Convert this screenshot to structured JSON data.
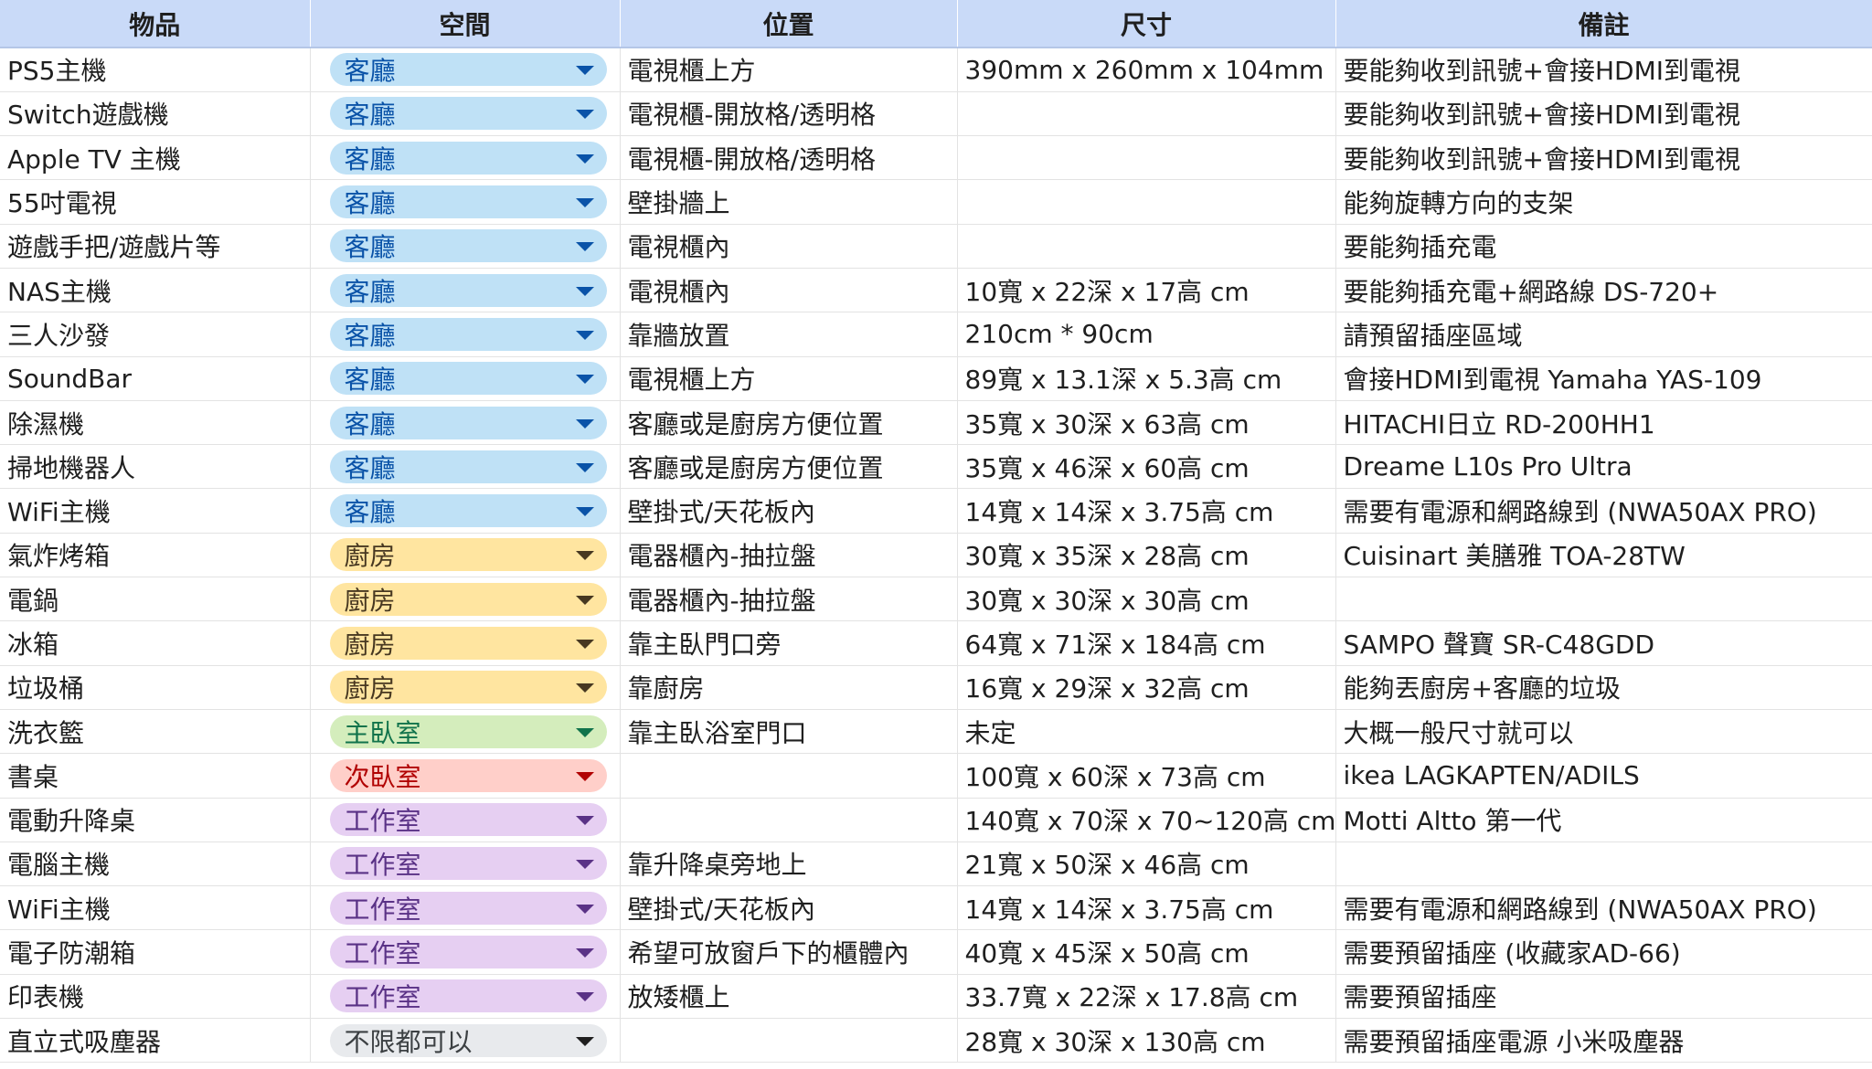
{
  "headers": [
    "物品",
    "空間",
    "位置",
    "尺寸",
    "備註"
  ],
  "space_colors": {
    "客廳": {
      "bg": "#bfe1f6",
      "fg": "#0a53a8",
      "arrow": "#0a53a8"
    },
    "廚房": {
      "bg": "#ffe5a0",
      "fg": "#473821",
      "arrow": "#473821"
    },
    "主臥室": {
      "bg": "#d4edbc",
      "fg": "#11734b",
      "arrow": "#11734b"
    },
    "次臥室": {
      "bg": "#ffcfc9",
      "fg": "#b10202",
      "arrow": "#b10202"
    },
    "工作室": {
      "bg": "#e6cff2",
      "fg": "#5a3286",
      "arrow": "#5a3286"
    },
    "不限都可以": {
      "bg": "#e8eaed",
      "fg": "#3c4043",
      "arrow": "#1f1f1f"
    }
  },
  "rows": [
    {
      "item": "PS5主機",
      "space": "客廳",
      "location": "電視櫃上方",
      "size": "390mm x 260mm x 104mm",
      "note": "要能夠收到訊號+會接HDMI到電視"
    },
    {
      "item": "Switch遊戲機",
      "space": "客廳",
      "location": "電視櫃-開放格/透明格",
      "size": "",
      "note": "要能夠收到訊號+會接HDMI到電視"
    },
    {
      "item": "Apple TV 主機",
      "space": "客廳",
      "location": "電視櫃-開放格/透明格",
      "size": "",
      "note": "要能夠收到訊號+會接HDMI到電視"
    },
    {
      "item": "55吋電視",
      "space": "客廳",
      "location": "壁掛牆上",
      "size": "",
      "note": "能夠旋轉方向的支架"
    },
    {
      "item": "遊戲手把/遊戲片等",
      "space": "客廳",
      "location": "電視櫃內",
      "size": "",
      "note": "要能夠插充電"
    },
    {
      "item": "NAS主機",
      "space": "客廳",
      "location": "電視櫃內",
      "size": "10寬 x 22深 x 17高 cm",
      "note": "要能夠插充電+網路線 DS-720+"
    },
    {
      "item": "三人沙發",
      "space": "客廳",
      "location": "靠牆放置",
      "size": "210cm * 90cm",
      "note": "請預留插座區域"
    },
    {
      "item": "SoundBar",
      "space": "客廳",
      "location": "電視櫃上方",
      "size": "89寬 x 13.1深 x 5.3高 cm",
      "note": "會接HDMI到電視 Yamaha YAS-109"
    },
    {
      "item": "除濕機",
      "space": "客廳",
      "location": "客廳或是廚房方便位置",
      "size": "35寬 x 30深 x 63高 cm",
      "note": "HITACHI日立 RD-200HH1"
    },
    {
      "item": "掃地機器人",
      "space": "客廳",
      "location": "客廳或是廚房方便位置",
      "size": "35寬 x 46深 x 60高 cm",
      "note": "Dreame L10s Pro Ultra"
    },
    {
      "item": "WiFi主機",
      "space": "客廳",
      "location": "壁掛式/天花板內",
      "size": "14寬 x 14深 x 3.75高 cm",
      "note": "需要有電源和網路線到 (NWA50AX PRO)"
    },
    {
      "item": "氣炸烤箱",
      "space": "廚房",
      "location": "電器櫃內-抽拉盤",
      "size": "30寬 x 35深 x 28高 cm",
      "note": "Cuisinart 美膳雅 TOA-28TW"
    },
    {
      "item": "電鍋",
      "space": "廚房",
      "location": "電器櫃內-抽拉盤",
      "size": "30寬 x 30深 x 30高 cm",
      "note": ""
    },
    {
      "item": "冰箱",
      "space": "廚房",
      "location": "靠主臥門口旁",
      "size": "64寬 x 71深 x 184高 cm",
      "note": "SAMPO 聲寶 SR-C48GDD"
    },
    {
      "item": "垃圾桶",
      "space": "廚房",
      "location": "靠廚房",
      "size": "16寬 x 29深 x 32高 cm",
      "note": "能夠丟廚房+客廳的垃圾"
    },
    {
      "item": "洗衣籃",
      "space": "主臥室",
      "location": "靠主臥浴室門口",
      "size": "未定",
      "note": "大概一般尺寸就可以"
    },
    {
      "item": "書桌",
      "space": "次臥室",
      "location": "",
      "size": "100寬 x 60深 x 73高 cm",
      "note": "ikea LAGKAPTEN/ADILS"
    },
    {
      "item": "電動升降桌",
      "space": "工作室",
      "location": "",
      "size": "140寬 x 70深 x 70~120高 cm",
      "note": "Motti Altto 第一代"
    },
    {
      "item": "電腦主機",
      "space": "工作室",
      "location": "靠升降桌旁地上",
      "size": "21寬 x 50深 x 46高 cm",
      "note": ""
    },
    {
      "item": "WiFi主機",
      "space": "工作室",
      "location": "壁掛式/天花板內",
      "size": "14寬 x 14深 x 3.75高 cm",
      "note": "需要有電源和網路線到 (NWA50AX PRO)"
    },
    {
      "item": "電子防潮箱",
      "space": "工作室",
      "location": "希望可放窗戶下的櫃體內",
      "size": "40寬 x 45深 x 50高 cm",
      "note": "需要預留插座 (收藏家AD-66)"
    },
    {
      "item": "印表機",
      "space": "工作室",
      "location": "放矮櫃上",
      "size": "33.7寬 x 22深 x 17.8高 cm",
      "note": "需要預留插座"
    },
    {
      "item": "直立式吸塵器",
      "space": "不限都可以",
      "location": "",
      "size": "28寬 x 30深 x 130高 cm",
      "note": "需要預留插座電源 小米吸塵器"
    }
  ]
}
